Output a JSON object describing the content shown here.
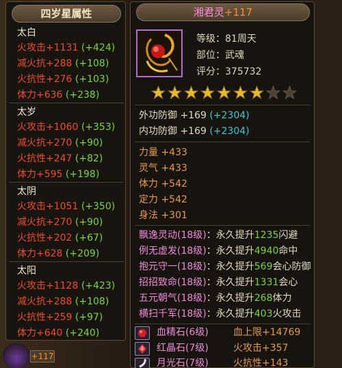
{
  "left": {
    "title": "四岁星属性",
    "groups": [
      {
        "name": "太白",
        "stats": [
          {
            "label": "火攻击+1131",
            "bonus": "(+424)"
          },
          {
            "label": "减火抗+288",
            "bonus": "(+108)"
          },
          {
            "label": "火抗性+276",
            "bonus": "(+103)"
          },
          {
            "label": "体力+636",
            "bonus": "(+238)"
          }
        ]
      },
      {
        "name": "太岁",
        "stats": [
          {
            "label": "火攻击+1060",
            "bonus": "(+353)"
          },
          {
            "label": "减火抗+270",
            "bonus": "(+90)"
          },
          {
            "label": "火抗性+247",
            "bonus": "(+82)"
          },
          {
            "label": "体力+595",
            "bonus": "(+198)"
          }
        ]
      },
      {
        "name": "太阴",
        "stats": [
          {
            "label": "火攻击+1051",
            "bonus": "(+350)"
          },
          {
            "label": "减火抗+270",
            "bonus": "(+90)"
          },
          {
            "label": "火抗性+202",
            "bonus": "(+67)"
          },
          {
            "label": "体力+628",
            "bonus": "(+209)"
          }
        ]
      },
      {
        "name": "太阳",
        "stats": [
          {
            "label": "火攻击+1128",
            "bonus": "(+423)"
          },
          {
            "label": "减火抗+288",
            "bonus": "(+108)"
          },
          {
            "label": "火抗性+259",
            "bonus": "(+97)"
          },
          {
            "label": "体力+640",
            "bonus": "(+240)"
          }
        ]
      }
    ],
    "corner_badge": "+117"
  },
  "item": {
    "name": "湘君灵",
    "enhance": "+117",
    "level": "等级：81周天",
    "slot": "部位：武魂",
    "score": "评分：375732",
    "stars_filled": 7,
    "stars_total": 9,
    "defense": [
      {
        "label": "外功防御 +169",
        "bonus": "(+2304)"
      },
      {
        "label": "内功防御 +169",
        "bonus": "(+2304)"
      }
    ],
    "attributes": [
      "力量 +433",
      "灵气 +433",
      "体力 +542",
      "定力 +542",
      "身法 +301"
    ],
    "skills": [
      {
        "name": "飘逸灵动(18级)",
        "pre": "：永久提升",
        "val": "1235",
        "post": "闪避"
      },
      {
        "name": "例无虚发(18级)",
        "pre": "：永久提升",
        "val": "4940",
        "post": "命中"
      },
      {
        "name": "抱元守一(18级)",
        "pre": "：永久提升",
        "val": "569",
        "post": "会心防御"
      },
      {
        "name": "招招致命(18级)",
        "pre": "：永久提升",
        "val": "1331",
        "post": "会心"
      },
      {
        "name": "五元朝气(18级)",
        "pre": "：永久提升",
        "val": "268",
        "post": "体力"
      },
      {
        "name": "横扫千军(18级)",
        "pre": "：永久提升",
        "val": "403",
        "post": "火攻击"
      }
    ],
    "gems": [
      {
        "name": "血精石(6级)",
        "effect": "血上限+14769",
        "icon": "blood-gem-icon"
      },
      {
        "name": "红晶石(7级)",
        "effect": "火攻击+357",
        "icon": "red-crystal-icon"
      },
      {
        "name": "月光石(7级)",
        "effect": "火抗性+143",
        "icon": "moonstone-icon"
      }
    ]
  },
  "colors": {
    "red": "#f04a2a",
    "green": "#7bd43c",
    "cyan": "#3fc6d6",
    "orange": "#e89a4a",
    "pink": "#ee8ad8",
    "star_gold": "#e8b830",
    "item_border": "#b36cd8"
  }
}
